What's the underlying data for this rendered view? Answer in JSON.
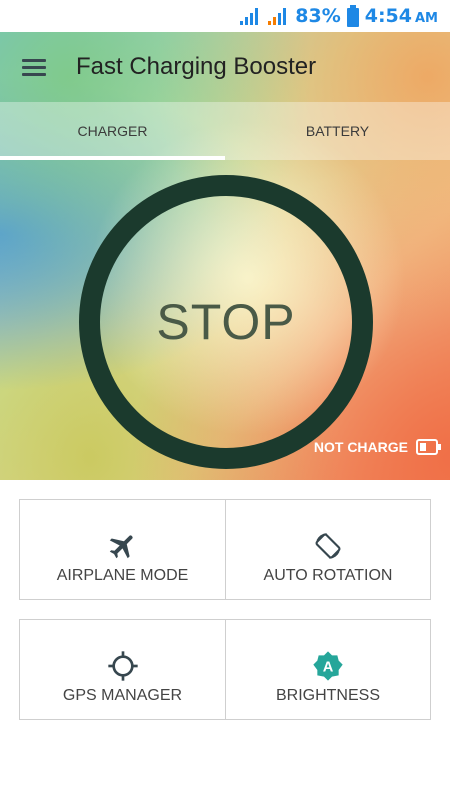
{
  "status_bar": {
    "battery_percent": "83%",
    "time": "4:54",
    "ampm": "AM",
    "accent_color": "#1e88e5"
  },
  "app": {
    "title": "Fast Charging Booster"
  },
  "tabs": [
    {
      "label": "CHARGER",
      "active": true
    },
    {
      "label": "BATTERY",
      "active": false
    }
  ],
  "main": {
    "action_label": "STOP",
    "charge_status": "NOT CHARGE",
    "ring_color": "#1b3a2d"
  },
  "tiles": [
    {
      "label": "AIRPLANE MODE",
      "icon": "airplane-icon"
    },
    {
      "label": "AUTO ROTATION",
      "icon": "rotation-icon"
    },
    {
      "label": "GPS MANAGER",
      "icon": "gps-icon"
    },
    {
      "label": "BRIGHTNESS",
      "icon": "brightness-icon",
      "color": "#26a69a"
    }
  ]
}
